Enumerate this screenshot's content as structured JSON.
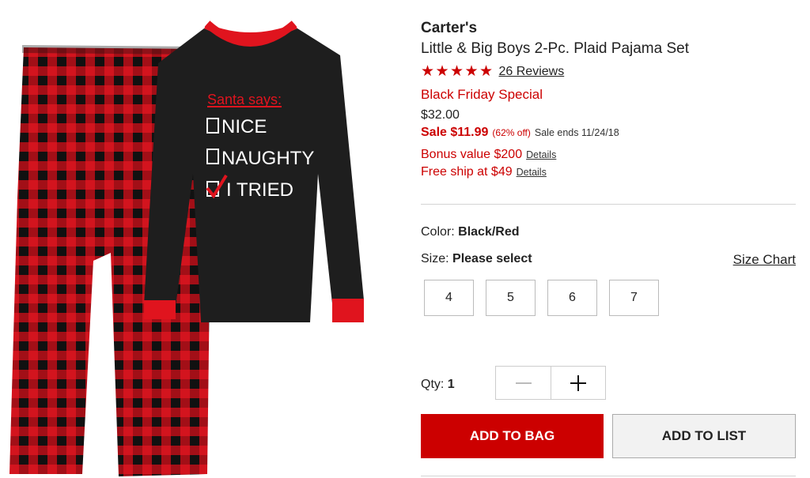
{
  "product": {
    "brand": "Carter's",
    "title": "Little & Big Boys 2-Pc. Plaid Pajama Set",
    "rating": 5,
    "reviews_label": "26 Reviews",
    "promo_label": "Black Friday Special",
    "original_price": "$32.00",
    "sale_price": "Sale $11.99",
    "sale_percent": "(62% off)",
    "sale_ends": "Sale ends 11/24/18",
    "shirt_print": {
      "heading": "Santa says:",
      "options": [
        "NICE",
        "NAUGHTY",
        "I TRIED"
      ],
      "checked_option": "I TRIED"
    }
  },
  "offers": [
    {
      "text": "Bonus value $200",
      "link": "Details"
    },
    {
      "text": "Free ship at $49",
      "link": "Details"
    }
  ],
  "color": {
    "label": "Color:",
    "value": "Black/Red"
  },
  "size": {
    "label": "Size:",
    "value": "Please select",
    "chart_link": "Size Chart",
    "options": [
      "4",
      "5",
      "6",
      "7"
    ]
  },
  "quantity": {
    "label": "Qty:",
    "value": "1",
    "decrement_icon": "minus-icon",
    "increment_icon": "plus-icon"
  },
  "actions": {
    "add_to_bag": "ADD TO BAG",
    "add_to_list": "ADD TO LIST"
  },
  "colors": {
    "accent_red": "#cc0000",
    "plaid_black": "#111111",
    "shirt_black": "#1e1e1e"
  }
}
